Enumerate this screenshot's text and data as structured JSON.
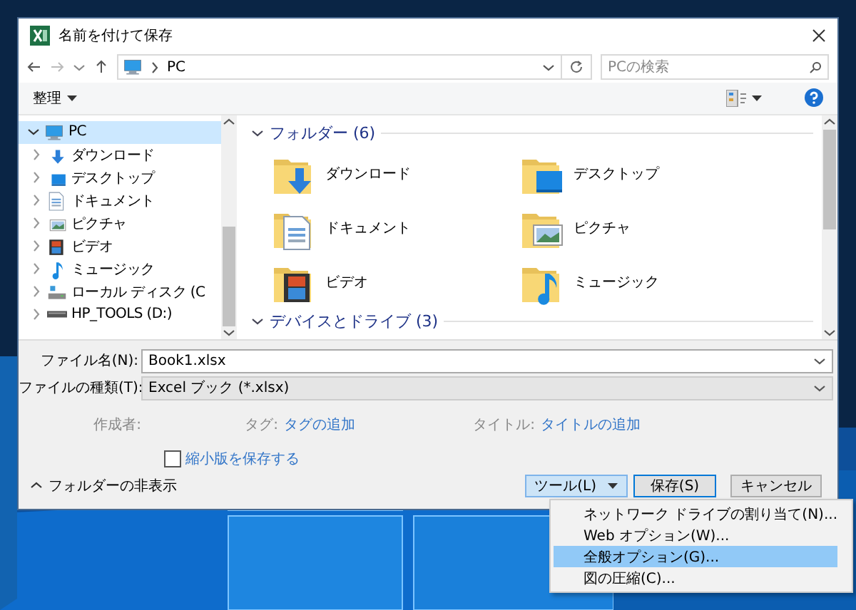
{
  "window": {
    "title": "名前を付けて保存"
  },
  "address": {
    "path": "PC",
    "search_placeholder": "PCの検索"
  },
  "toolbar": {
    "organize": "整理"
  },
  "nav_pane": [
    {
      "label": "PC",
      "kind": "pc",
      "expanded": true,
      "selected": true,
      "children": [
        {
          "label": "ダウンロード",
          "kind": "download",
          "expanded": false,
          "selected": false
        },
        {
          "label": "デスクトップ",
          "kind": "desktop",
          "expanded": false,
          "selected": false
        },
        {
          "label": "ドキュメント",
          "kind": "document",
          "expanded": false,
          "selected": false
        },
        {
          "label": "ピクチャ",
          "kind": "picture",
          "expanded": false,
          "selected": false
        },
        {
          "label": "ビデオ",
          "kind": "video",
          "expanded": false,
          "selected": false
        },
        {
          "label": "ミュージック",
          "kind": "music",
          "expanded": false,
          "selected": false
        },
        {
          "label": "ローカル ディスク (C",
          "kind": "disk",
          "expanded": false,
          "selected": false
        },
        {
          "label": "HP_TOOLS (D:)",
          "kind": "drive",
          "expanded": false,
          "selected": false
        }
      ]
    }
  ],
  "groups": [
    {
      "title": "フォルダー (6)",
      "items": [
        {
          "label": "ダウンロード",
          "kind": "download"
        },
        {
          "label": "デスクトップ",
          "kind": "desktop"
        },
        {
          "label": "ドキュメント",
          "kind": "document"
        },
        {
          "label": "ピクチャ",
          "kind": "picture"
        },
        {
          "label": "ビデオ",
          "kind": "video"
        },
        {
          "label": "ミュージック",
          "kind": "music"
        }
      ]
    },
    {
      "title": "デバイスとドライブ (3)"
    }
  ],
  "file_name": {
    "label": "ファイル名(N):",
    "value": "Book1.xlsx"
  },
  "file_type": {
    "label": "ファイルの種類(T):",
    "value": "Excel ブック (*.xlsx)"
  },
  "metadata": [
    {
      "label": "作成者:"
    },
    {
      "label": "タグ:",
      "link": "タグの追加"
    },
    {
      "label": "タイトル:",
      "link": "タイトルの追加"
    }
  ],
  "thumbnail_checkbox": {
    "label": "縮小版を保存する",
    "checked": false
  },
  "hide_folders": "フォルダーの非表示",
  "buttons": [
    {
      "label": "ツール(L)",
      "kind": "menu",
      "open": true
    },
    {
      "label": "保存(S)",
      "kind": "default"
    },
    {
      "label": "キャンセル",
      "kind": "plain"
    }
  ],
  "tools_menu": [
    {
      "label": "ネットワーク ドライブの割り当て(N)...",
      "selected": false
    },
    {
      "label": "Web オプション(W)...",
      "selected": false
    },
    {
      "label": "全般オプション(G)...",
      "selected": true
    },
    {
      "label": "図の圧縮(C)...",
      "selected": false
    }
  ]
}
